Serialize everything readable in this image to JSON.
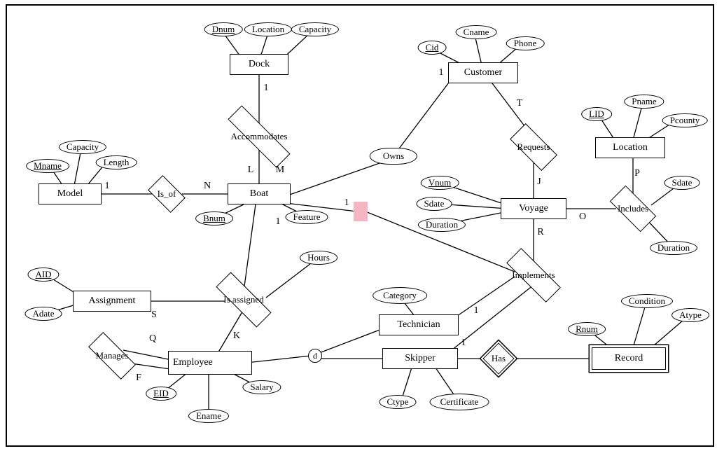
{
  "entities": {
    "dock": "Dock",
    "customer": "Customer",
    "location": "Location",
    "model": "Model",
    "boat": "Boat",
    "voyage": "Voyage",
    "assignment": "Assignment",
    "technician": "Technician",
    "employee": "Employee",
    "skipper": "Skipper",
    "record": "Record"
  },
  "relationships": {
    "accommodates": "Accommodates",
    "is_of": "Is_of",
    "owns": "Owns",
    "requests": "Requests",
    "includes": "Includes",
    "implements": "Implements",
    "is_assigned": "Is  assigned",
    "manages": "Manages",
    "has": "Has"
  },
  "attributes": {
    "dnum": "Dnum",
    "dlocation": "Location",
    "dcapacity": "Capacity",
    "cid": "Cid",
    "cname": "Cname",
    "phone": "Phone",
    "lid": "LID",
    "pname": "Pname",
    "pcounty": "Pcounty",
    "mcapacity": "Capacity",
    "mname": "Mname",
    "mlength": "Length",
    "bnum": "Bnum",
    "feature": "Feature",
    "vnum": "Vnum",
    "vsdate": "Sdate",
    "vduration": "Duration",
    "isdate": "Sdate",
    "iduration": "Duration",
    "hours": "Hours",
    "aid": "AID",
    "adate": "Adate",
    "category": "Category",
    "eid": "EID",
    "ename": "Ename",
    "salary": "Salary",
    "ctype": "Ctype",
    "certificate": "Certificate",
    "rnum": "Rnum",
    "condition": "Condition",
    "atype": "Atype"
  },
  "cards": {
    "dock_acc": "1",
    "acc_boat_L": "L",
    "acc_boat_M": "M",
    "model_isof": "1",
    "isof_boat": "N",
    "cust_owns": "1",
    "boat_owns": "1",
    "cust_req": "T",
    "req_voy": "J",
    "voy_inc": "O",
    "inc_loc": "P",
    "voy_impl": "R",
    "tech_impl": "1",
    "skip_impl": "1",
    "assign_S": "S",
    "emp_K": "K",
    "man_Q": "Q",
    "man_F": "F",
    "d": "d",
    "boat_assigned": "1"
  },
  "colors": {
    "pink": "#f4b6c2"
  }
}
